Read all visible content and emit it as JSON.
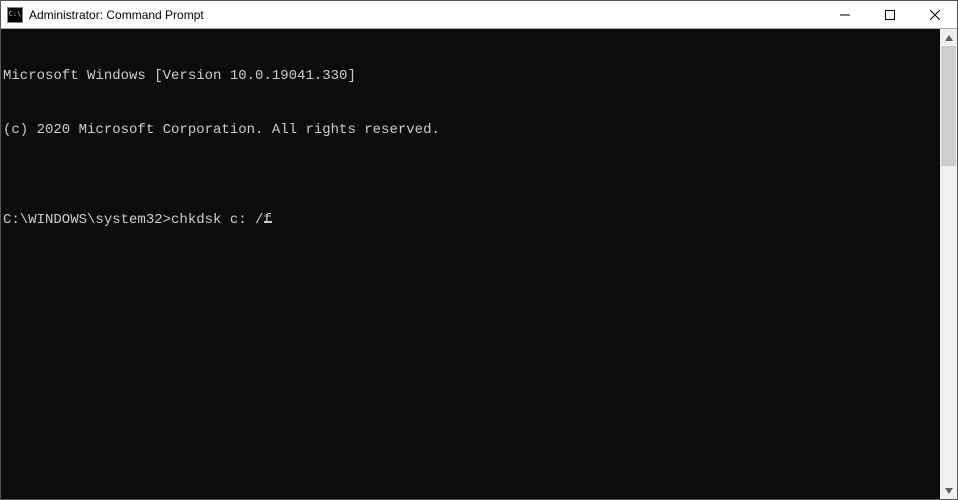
{
  "titlebar": {
    "icon_label": "C:\\",
    "title": "Administrator: Command Prompt"
  },
  "terminal": {
    "line1": "Microsoft Windows [Version 10.0.19041.330]",
    "line2": "(c) 2020 Microsoft Corporation. All rights reserved.",
    "blank": "",
    "prompt": "C:\\WINDOWS\\system32>",
    "command": "chkdsk c: /f"
  }
}
